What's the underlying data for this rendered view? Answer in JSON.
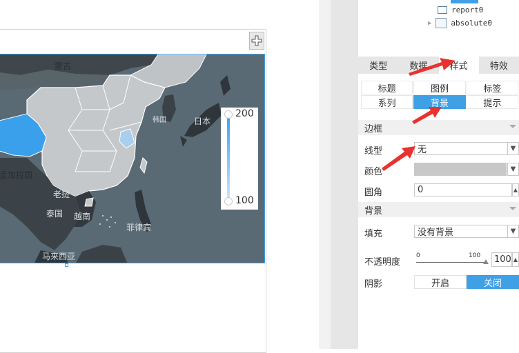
{
  "tree": {
    "items": [
      {
        "label": "report0",
        "icon": "report-icon"
      },
      {
        "label": "absolute0",
        "icon": "absolute-layout-icon"
      }
    ]
  },
  "main_tabs": [
    {
      "label": "类型",
      "active": false
    },
    {
      "label": "数据",
      "active": false
    },
    {
      "label": "样式",
      "active": true
    },
    {
      "label": "特效",
      "active": false
    }
  ],
  "sub_tabs_row1": [
    {
      "label": "标题",
      "active": false
    },
    {
      "label": "图例",
      "active": false
    },
    {
      "label": "标签",
      "active": false
    }
  ],
  "sub_tabs_row2": [
    {
      "label": "系列",
      "active": false
    },
    {
      "label": "背景",
      "active": true
    },
    {
      "label": "提示",
      "active": false
    }
  ],
  "border_section": {
    "title": "边框",
    "line_type_label": "线型",
    "line_type_value": "无",
    "color_label": "颜色",
    "radius_label": "圆角",
    "radius_value": "0"
  },
  "background_section": {
    "title": "背景",
    "fill_label": "填充",
    "fill_value": "没有背景",
    "opacity_label": "不透明度",
    "opacity_min": "0",
    "opacity_max": "100",
    "opacity_value": "100",
    "shadow_label": "阴影",
    "shadow_on": "开启",
    "shadow_off": "关闭",
    "shadow_selected": "关闭"
  },
  "map": {
    "labels": {
      "mongolia": "蒙古",
      "korea": "韩国",
      "japan": "日本",
      "bangladesh": "孟加拉国",
      "laos": "老挝",
      "thailand": "泰国",
      "vietnam": "越南",
      "philippines": "菲律宾",
      "malaysia": "马来西亚"
    },
    "legend": {
      "max": "200",
      "min": "100"
    },
    "colors": {
      "ocean": "#5a6a74",
      "land_china": "#c4c8cb",
      "highlight": "#3aa0ec",
      "highlight_light": "#a8cfee"
    }
  },
  "colors": {
    "accent": "#3fa0e6",
    "arrow": "#e8322d"
  }
}
